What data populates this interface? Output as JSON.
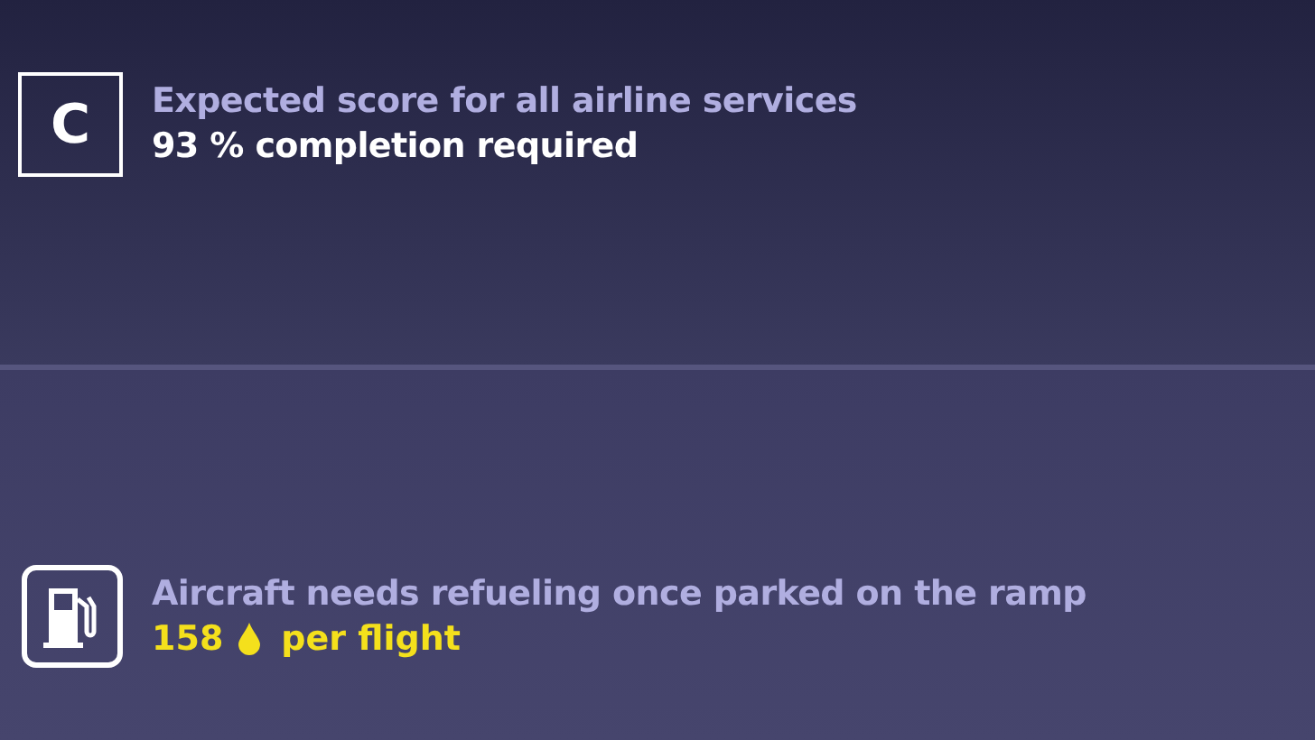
{
  "requirements": [
    {
      "kind": "grade",
      "grade": "C",
      "title": "Expected score for all airline services",
      "detail": "93 % completion required"
    },
    {
      "kind": "fuel",
      "title": "Aircraft needs refueling once parked on the ramp",
      "amount": "158",
      "suffix": "per flight"
    }
  ]
}
